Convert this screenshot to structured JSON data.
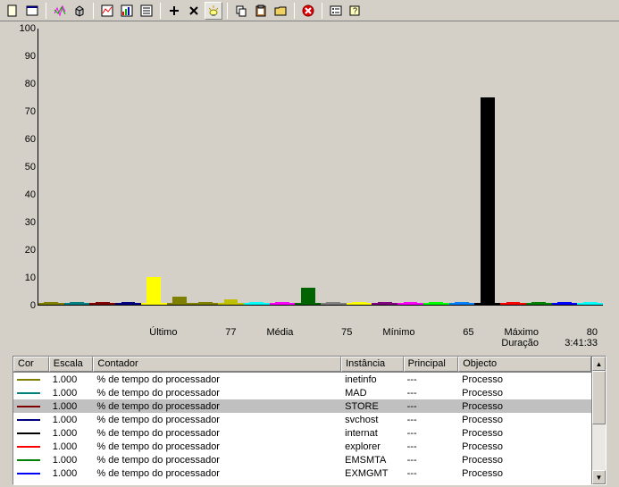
{
  "toolbar": {
    "icons": [
      "new",
      "window",
      "spark",
      "cube",
      "chart",
      "gauge",
      "log",
      "add",
      "delete",
      "highlight",
      "copy",
      "paste",
      "folder",
      "stop",
      "options",
      "help"
    ]
  },
  "chart_data": {
    "type": "bar",
    "ylim": [
      0,
      100
    ],
    "yticks": [
      0,
      10,
      20,
      30,
      40,
      50,
      60,
      70,
      80,
      90,
      100
    ],
    "series": [
      {
        "color": "#808000",
        "value": 1
      },
      {
        "color": "#008080",
        "value": 1
      },
      {
        "color": "#800000",
        "value": 1
      },
      {
        "color": "#000080",
        "value": 1
      },
      {
        "color": "#ffff00",
        "value": 10
      },
      {
        "color": "#808000",
        "value": 3
      },
      {
        "color": "#808000",
        "value": 1
      },
      {
        "color": "#c0c000",
        "value": 2
      },
      {
        "color": "#00ffff",
        "value": 1
      },
      {
        "color": "#ff00ff",
        "value": 1
      },
      {
        "color": "#006400",
        "value": 6
      },
      {
        "color": "#808080",
        "value": 1
      },
      {
        "color": "#ffff00",
        "value": 1
      },
      {
        "color": "#800080",
        "value": 1
      },
      {
        "color": "#ff00ff",
        "value": 1
      },
      {
        "color": "#00ff00",
        "value": 1
      },
      {
        "color": "#0080ff",
        "value": 1
      },
      {
        "color": "#000000",
        "value": 75
      },
      {
        "color": "#ff0000",
        "value": 1
      },
      {
        "color": "#008000",
        "value": 1
      },
      {
        "color": "#0000ff",
        "value": 1
      },
      {
        "color": "#00ffff",
        "value": 1
      }
    ]
  },
  "stats": {
    "ultimo_label": "Último",
    "ultimo": "77",
    "media_label": "Média",
    "media": "75",
    "minimo_label": "Mínimo",
    "minimo": "65",
    "maximo_label": "Máximo",
    "maximo": "80",
    "duracao_label": "Duração",
    "duracao": "3:41:33"
  },
  "grid": {
    "headers": {
      "cor": "Cor",
      "escala": "Escala",
      "contador": "Contador",
      "instancia": "Instância",
      "principal": "Principal",
      "objecto": "Objecto"
    },
    "rows": [
      {
        "color": "#808000",
        "escala": "1.000",
        "contador": "% de tempo do processador",
        "instancia": "inetinfo",
        "principal": "---",
        "objecto": "Processo",
        "sel": false
      },
      {
        "color": "#008080",
        "escala": "1.000",
        "contador": "% de tempo do processador",
        "instancia": "MAD",
        "principal": "---",
        "objecto": "Processo",
        "sel": false
      },
      {
        "color": "#800000",
        "escala": "1.000",
        "contador": "% de tempo do processador",
        "instancia": "STORE",
        "principal": "---",
        "objecto": "Processo",
        "sel": true
      },
      {
        "color": "#000080",
        "escala": "1.000",
        "contador": "% de tempo do processador",
        "instancia": "svchost",
        "principal": "---",
        "objecto": "Processo",
        "sel": false
      },
      {
        "color": "#000000",
        "escala": "1.000",
        "contador": "% de tempo do processador",
        "instancia": "internat",
        "principal": "---",
        "objecto": "Processo",
        "sel": false
      },
      {
        "color": "#ff0000",
        "escala": "1.000",
        "contador": "% de tempo do processador",
        "instancia": "explorer",
        "principal": "---",
        "objecto": "Processo",
        "sel": false
      },
      {
        "color": "#008000",
        "escala": "1.000",
        "contador": "% de tempo do processador",
        "instancia": "EMSMTA",
        "principal": "---",
        "objecto": "Processo",
        "sel": false
      },
      {
        "color": "#0000ff",
        "escala": "1.000",
        "contador": "% de tempo do processador",
        "instancia": "EXMGMT",
        "principal": "---",
        "objecto": "Processo",
        "sel": false
      }
    ]
  }
}
